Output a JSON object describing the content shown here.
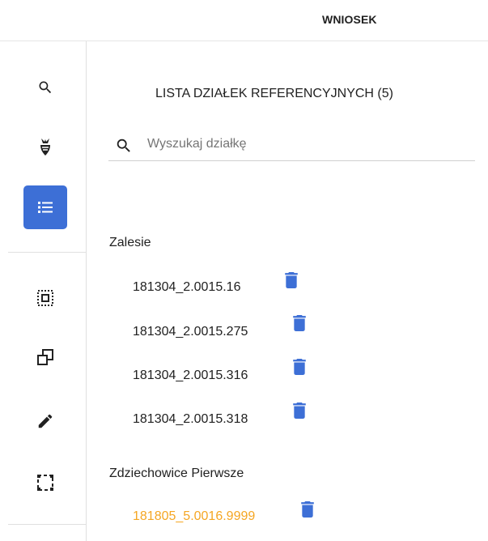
{
  "header": {
    "tab_label": "WNIOSEK"
  },
  "sidebar": {
    "tools": [
      {
        "icon": "search-icon",
        "active": false
      },
      {
        "icon": "crop-icon",
        "active": false
      },
      {
        "icon": "list-icon",
        "active": true
      },
      {
        "icon": "select-area-icon",
        "active": false
      },
      {
        "icon": "copy-icon",
        "active": false
      },
      {
        "icon": "pencil-icon",
        "active": false
      },
      {
        "icon": "selection-frame-icon",
        "active": false
      }
    ],
    "active_color": "#3d6fd6"
  },
  "main": {
    "title": "LISTA DZIAŁEK REFERENCYJNYCH (5)",
    "search": {
      "placeholder": "Wyszukaj działkę",
      "value": ""
    },
    "groups": [
      {
        "name": "Zalesie",
        "parcels": [
          {
            "id": "181304_2.0015.16",
            "highlighted": false
          },
          {
            "id": "181304_2.0015.275",
            "highlighted": false
          },
          {
            "id": "181304_2.0015.316",
            "highlighted": false
          },
          {
            "id": "181304_2.0015.318",
            "highlighted": false
          }
        ]
      },
      {
        "name": "Zdziechowice Pierwsze",
        "parcels": [
          {
            "id": "181805_5.0016.9999",
            "highlighted": true
          }
        ]
      }
    ]
  },
  "colors": {
    "trash": "#3d6fd6",
    "highlight": "#f5a623"
  }
}
